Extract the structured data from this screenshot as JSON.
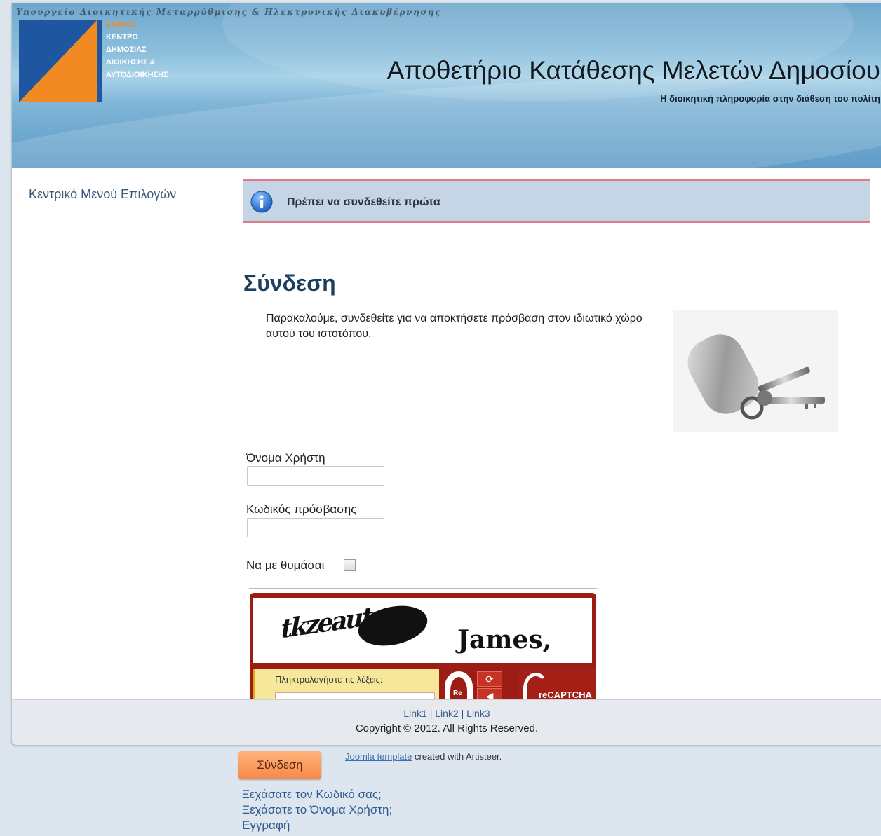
{
  "header": {
    "ministry": "Υπουργείο Διοικητικής Μεταρρύθμισης & Ηλεκτρονικής Διακυβέρνησης",
    "logo_lines": [
      "ΕΘΝΙΚΟ",
      "ΚΕΝΤΡΟ",
      "ΔΗΜΟΣΙΑΣ",
      "ΔΙΟΙΚΗΣΗΣ &",
      "ΑΥΤΟΔΙΟΙΚΗΣΗΣ"
    ],
    "site_title": "Αποθετήριο Κατάθεσης Μελετών Δημοσίου",
    "slogan": "Η διοικητική πληροφορία στην διάθεση του πολίτη"
  },
  "sidebar": {
    "title": "Κεντρικό Μενού Επιλογών"
  },
  "message": {
    "text": "Πρέπει να συνδεθείτε πρώτα"
  },
  "login": {
    "title": "Σύνδεση",
    "intro": "Παρακαλούμε, συνδεθείτε για να αποκτήσετε πρόσβαση στον ιδιωτικό χώρο αυτού του ιστοτόπου.",
    "username_label": "Όνομα Χρήστη",
    "username_value": "",
    "password_label": "Κωδικός πρόσβασης",
    "password_value": "",
    "remember_label": "Να με θυμάσαι",
    "submit_label": "Σύνδεση",
    "forgot_password": "Ξεχάσατε τον Κωδικό σας;",
    "forgot_username": "Ξεχάσατε το Όνομα Χρήστη;",
    "register": "Εγγραφή"
  },
  "captcha": {
    "word1": "tkzeaut",
    "word2": "James,",
    "prompt": "Πληκτρολογήστε τις λέξεις:",
    "re_label": "Re",
    "logo_text": "reCAPTCHA"
  },
  "footer": {
    "links": [
      "Link1",
      "Link2",
      "Link3"
    ],
    "copyright": "Copyright © 2012. All Rights Reserved."
  },
  "credit": {
    "link_text": "Joomla template",
    "suffix": " created with Artisteer."
  },
  "colors": {
    "accent_orange": "#f7884a",
    "message_border": "#e07a86",
    "title_blue": "#1d3f5e",
    "captcha_red": "#9b1d14"
  }
}
